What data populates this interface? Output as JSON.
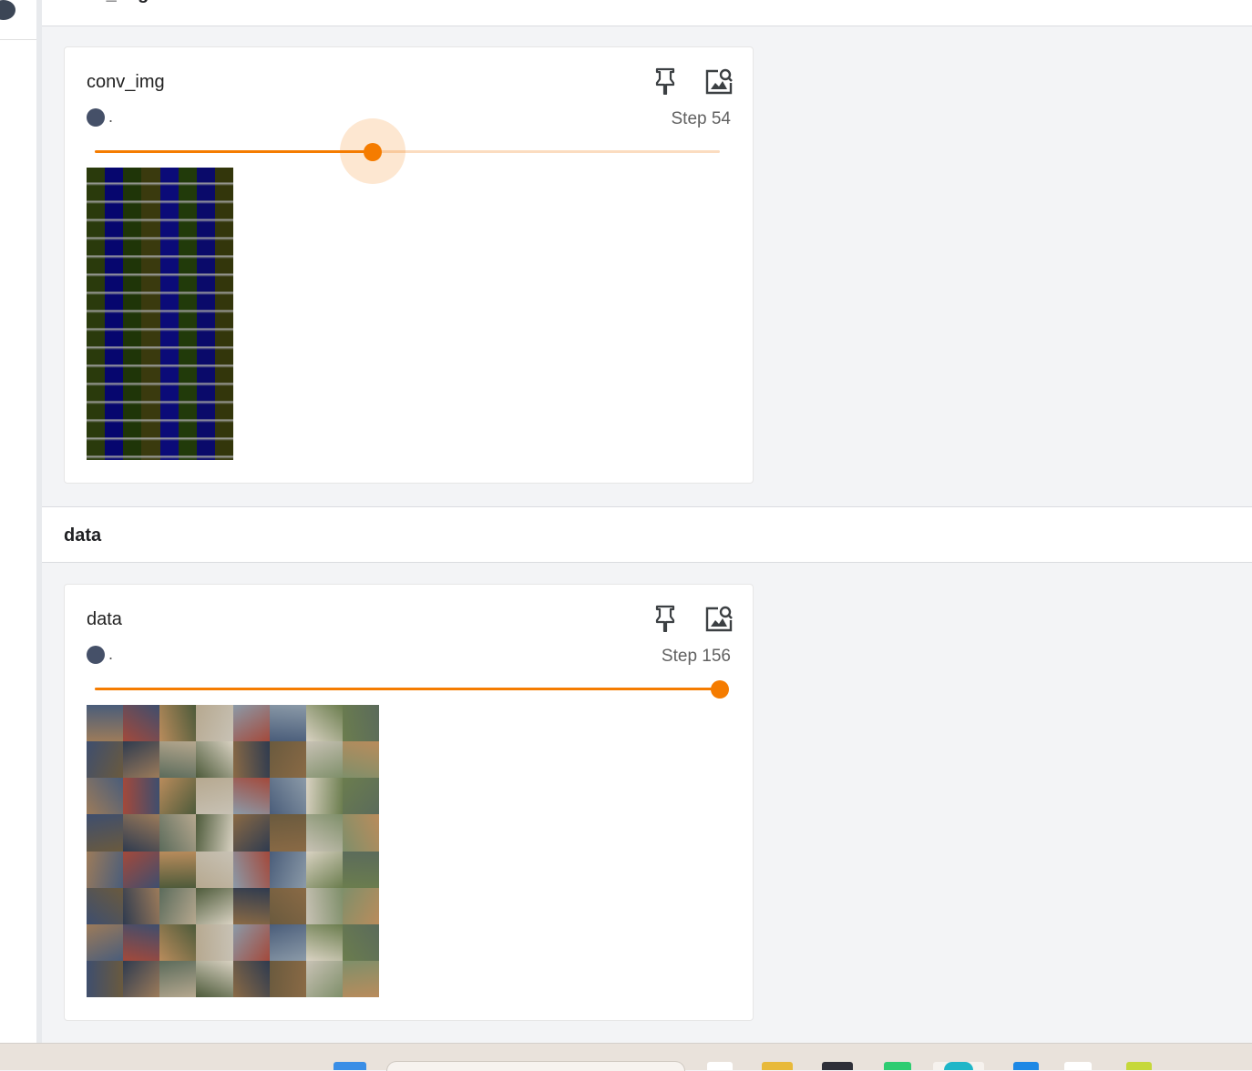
{
  "groups": [
    {
      "title": "conv_img"
    },
    {
      "title": "data"
    }
  ],
  "cards": [
    {
      "title": "conv_img",
      "run_label": ".",
      "step_label": "Step 54",
      "slider_fraction": 0.444
    },
    {
      "title": "data",
      "run_label": ".",
      "step_label": "Step 156",
      "slider_fraction": 1.0
    }
  ],
  "colors": {
    "accent": "#f57c00",
    "accent_light": "#fbdcc0",
    "run_dot": "#455068"
  },
  "icons": {
    "pin": "pin-icon",
    "zoom": "image-search-icon"
  }
}
